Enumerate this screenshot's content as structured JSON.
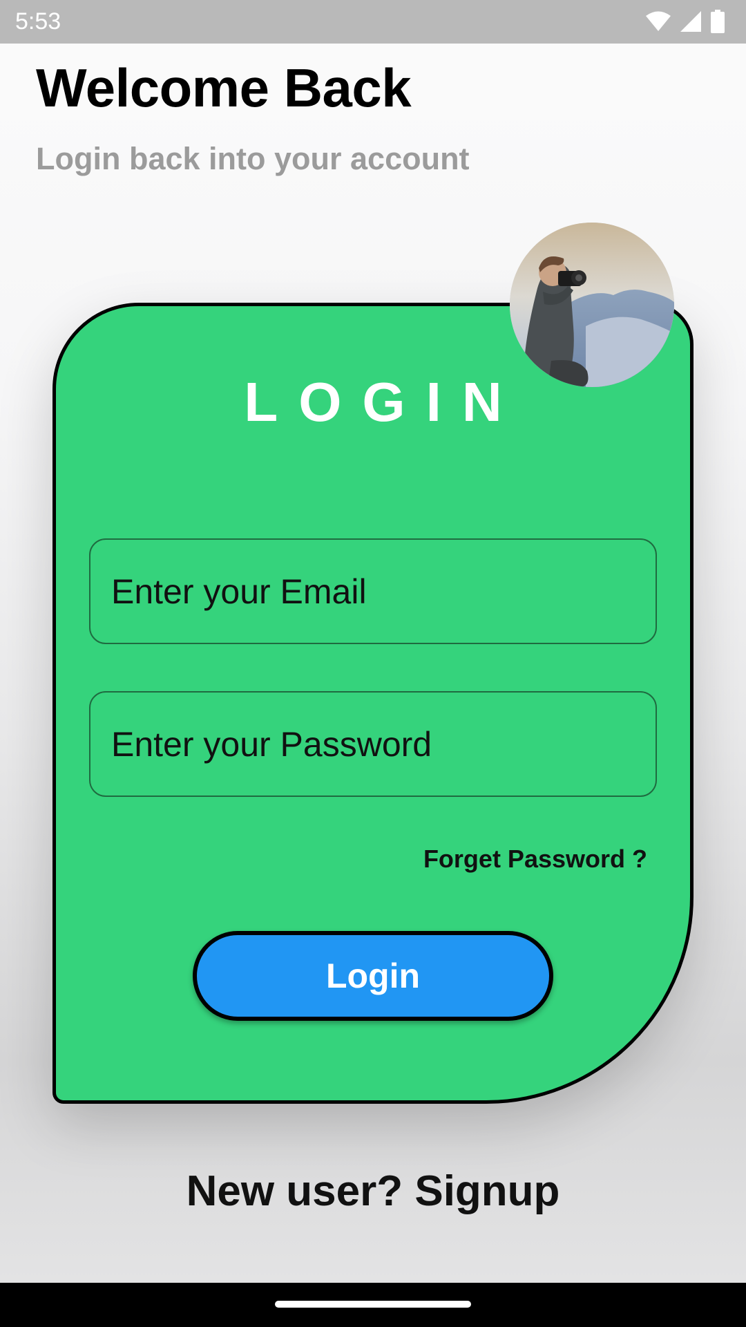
{
  "status_bar": {
    "time": "5:53",
    "icons": [
      "wifi-icon",
      "signal-icon",
      "battery-icon"
    ]
  },
  "header": {
    "title": "Welcome Back",
    "subtitle": "Login back into your account"
  },
  "card": {
    "heading": "LOGIN",
    "avatar_description": "avatar-photo",
    "email_placeholder": "Enter your Email",
    "password_placeholder": "Enter your Password",
    "forget_password_label": "Forget Password ?",
    "login_button_label": "Login"
  },
  "footer": {
    "signup_label": "New user? Signup"
  },
  "colors": {
    "card_background": "#35d37c",
    "button_background": "#2196f3",
    "status_bar": "#b9b9b9",
    "subtitle": "#9b9b9b"
  }
}
